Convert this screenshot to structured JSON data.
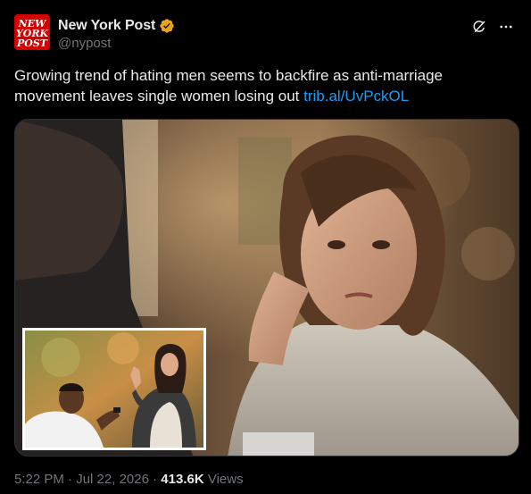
{
  "account": {
    "display_name": "New York Post",
    "handle": "@nypost",
    "avatar_text": [
      "NEW",
      "YORK",
      "POST"
    ],
    "avatar_color": "#d40000",
    "verified_badge_color": "#e8a317"
  },
  "header_actions": {
    "grok_icon": "grok-icon",
    "more_icon": "more-icon"
  },
  "post": {
    "text": "Growing trend of hating men seems to backfire as anti-marriage movement leaves single women losing out ",
    "link": "trib.al/UvPckOL"
  },
  "media": {
    "main_image": "woman-at-cafe-photo",
    "inset_image": "proposal-rejection-photo"
  },
  "meta": {
    "time": "5:22 PM",
    "separator": " · ",
    "date": "Jul 22, 2026",
    "views_count": "413.6K",
    "views_label": " Views"
  },
  "colors": {
    "background": "#000000",
    "text": "#e7e9ea",
    "secondary_text": "#71767b",
    "link": "#1d9bf0"
  }
}
